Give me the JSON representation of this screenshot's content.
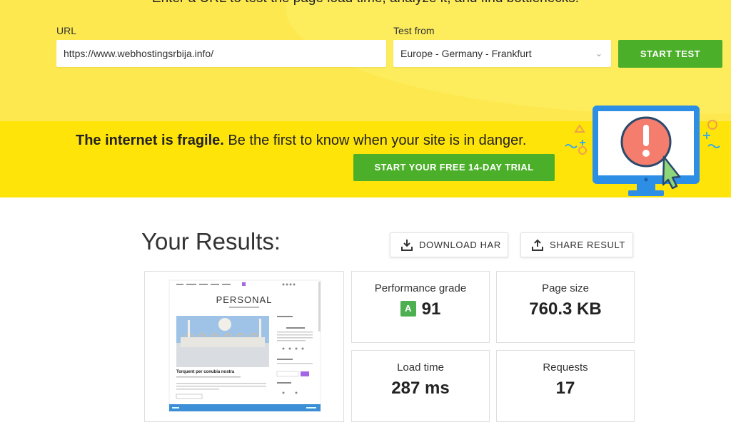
{
  "form": {
    "intro": "Enter a URL to test the page load time, analyze it, and find bottlenecks.",
    "url_label": "URL",
    "url_value": "https://www.webhostingsrbija.info/",
    "from_label": "Test from",
    "from_value": "Europe - Germany - Frankfurt",
    "start_label": "START TEST"
  },
  "promo": {
    "bold": "The internet is fragile.",
    "text": " Be the first to know when your site is in danger.",
    "trial_label": "START YOUR FREE 14-DAY TRIAL"
  },
  "results": {
    "title": "Your Results:",
    "download_label": "DOWNLOAD HAR",
    "share_label": "SHARE RESULT",
    "preview": {
      "site_title": "PERSONAL",
      "post_title": "Torquent per conubia nostra"
    },
    "performance": {
      "label": "Performance grade",
      "grade": "A",
      "score": "91"
    },
    "page_size": {
      "label": "Page size",
      "value": "760.3 KB"
    },
    "load_time": {
      "label": "Load time",
      "value": "287 ms"
    },
    "requests": {
      "label": "Requests",
      "value": "17"
    }
  },
  "colors": {
    "yellow": "#fde94f",
    "promo_yellow": "#ffe40a",
    "green": "#4caf2a",
    "grade_green": "#4caf50"
  }
}
